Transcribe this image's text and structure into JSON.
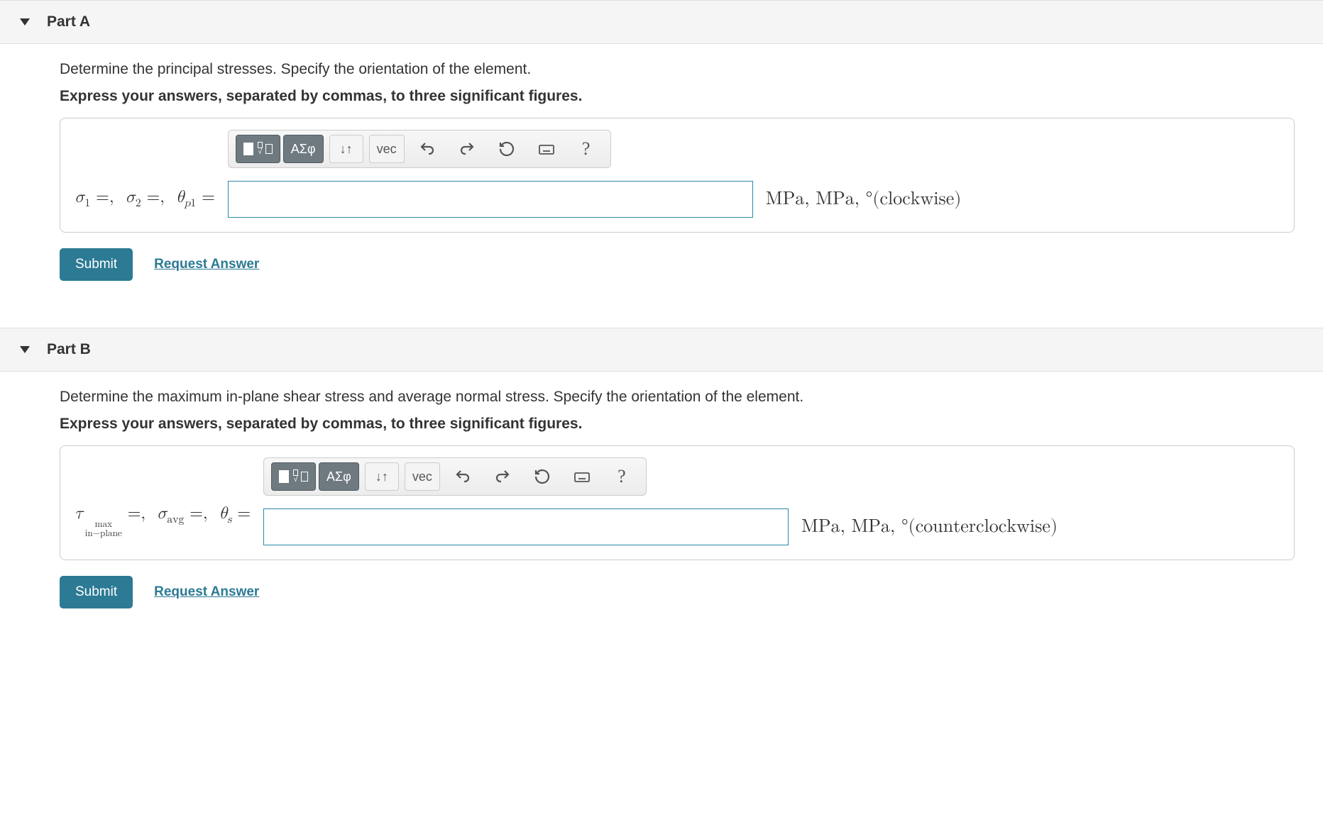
{
  "parts": [
    {
      "title": "Part A",
      "prompt1": "Determine the principal stresses. Specify the orientation of the element.",
      "prompt2": "Express your answers, separated by commas, to three significant figures.",
      "var_label_html": "σ₁ =,  σ₂ =,  θ_p1 =",
      "units": "MPa,  MPa,  °(clockwise)",
      "submit": "Submit",
      "request": "Request Answer"
    },
    {
      "title": "Part B",
      "prompt1": "Determine the maximum in-plane shear stress and average normal stress. Specify the orientation of the element.",
      "prompt2": "Express your answers, separated by commas, to three significant figures.",
      "var_label_html": "τ_{max,in-plane} =,  σ_avg =,  θ_s =",
      "units": "MPa,  MPa,  °(counterclockwise)",
      "submit": "Submit",
      "request": "Request Answer"
    }
  ],
  "toolbar": {
    "templates_label": "templates",
    "greek_label": "ΑΣφ",
    "subsup_label": "↓↑",
    "vec_label": "vec",
    "undo_label": "undo",
    "redo_label": "redo",
    "reset_label": "reset",
    "keyboard_label": "keyboard",
    "help_label": "?"
  }
}
